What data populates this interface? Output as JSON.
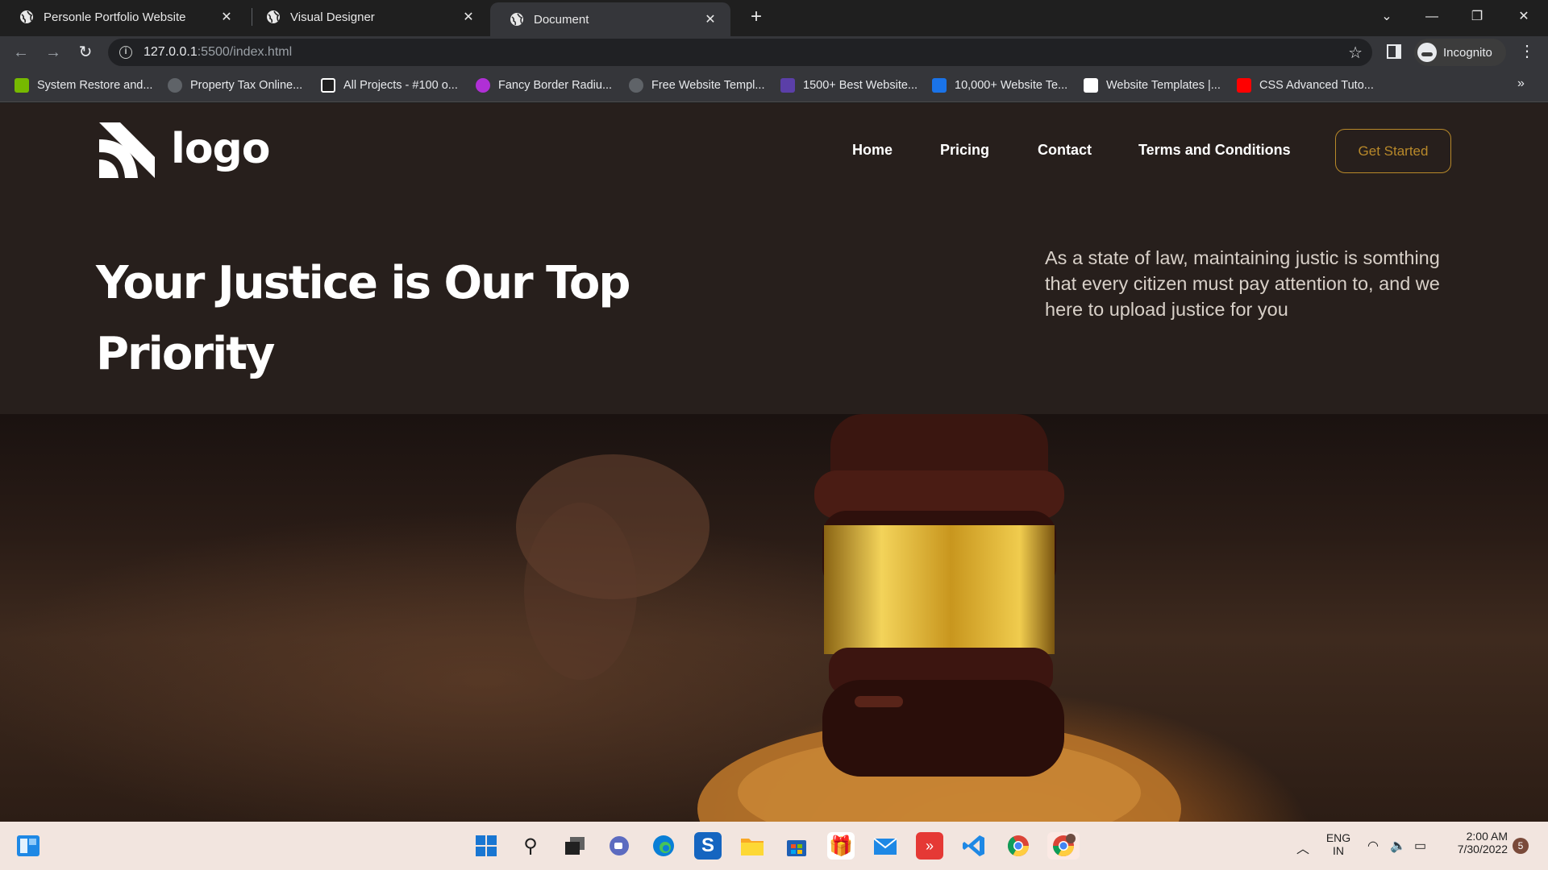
{
  "browser": {
    "tabs": [
      {
        "title": "Personle Portfolio Website"
      },
      {
        "title": "Visual Designer"
      },
      {
        "title": "Document"
      }
    ],
    "address": {
      "host": "127.0.0.1",
      "path": ":5500/index.html"
    },
    "profile_label": "Incognito",
    "bookmarks": [
      {
        "label": "System Restore and...",
        "icon_color": "#76b900"
      },
      {
        "label": "Property Tax Online...",
        "icon_color": "#9aa0a6"
      },
      {
        "label": "All Projects - #100 o...",
        "icon_color": "#ffffff"
      },
      {
        "label": "Fancy Border Radiu...",
        "icon_color": "#b02fd6"
      },
      {
        "label": "Free Website Templ...",
        "icon_color": "#9aa0a6"
      },
      {
        "label": "1500+ Best Website...",
        "icon_color": "#5b3fa8"
      },
      {
        "label": "10,000+ Website Te...",
        "icon_color": "#1a73e8"
      },
      {
        "label": "Website Templates |...",
        "icon_color": "#ffffff"
      },
      {
        "label": "CSS Advanced Tuto...",
        "icon_color": "#ff0000"
      }
    ]
  },
  "site": {
    "logo_text": "logo",
    "nav": [
      "Home",
      "Pricing",
      "Contact",
      "Terms and Conditions"
    ],
    "cta": "Get Started",
    "hero_title": "Your Justice is Our Top Priority",
    "hero_desc": "As a state of law, maintaining justic is somthing that every citizen must pay attention to, and we here to upload justice for you",
    "hero_image_name": "judge-gavel-photo"
  },
  "taskbar": {
    "lang": "ENG",
    "region": "IN",
    "time": "2:00 AM",
    "date": "7/30/2022",
    "notifications": "5"
  },
  "colors": {
    "page_bg": "#271f1c",
    "accent": "#b8892a"
  }
}
